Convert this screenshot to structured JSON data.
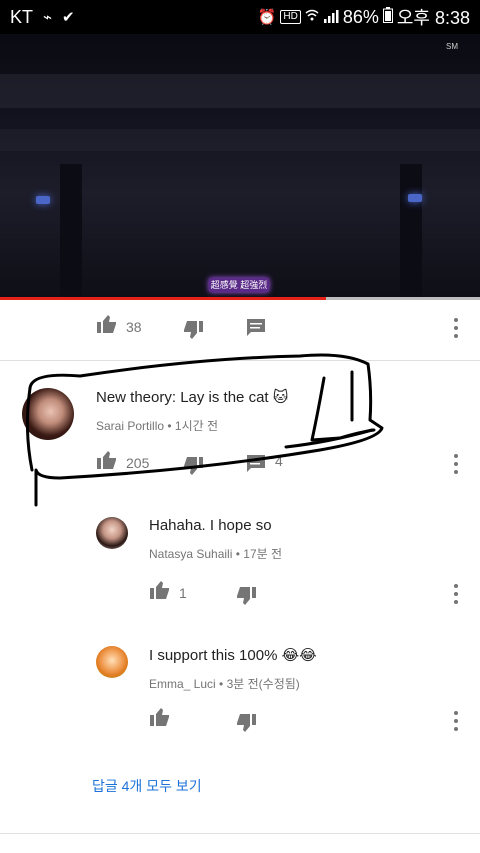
{
  "status_bar": {
    "carrier": "KT",
    "hd_badge": "HD",
    "battery": "86%",
    "time": "오후 8:38"
  },
  "video": {
    "subtitle_text": "超感覺 超強烈",
    "progress_percent": 68,
    "accent_color": "#e62117"
  },
  "video_actions": {
    "like_count": "38"
  },
  "comments": [
    {
      "text": "New theory: Lay is the cat",
      "emoji": "🐱",
      "author": "Sarai Portillo",
      "time": "1시간 전",
      "like_count": "205",
      "reply_count": "4"
    }
  ],
  "replies": [
    {
      "text": "Hahaha. I hope so",
      "author": "Natasya Suhaili",
      "time": "17분 전",
      "like_count": "1"
    },
    {
      "text": "I support this 100% 😂😂",
      "author": "Emma_ Luci",
      "time": "3분 전(수정됨)",
      "like_count": ""
    }
  ],
  "view_all_replies": "답글 4개 모두 보기",
  "separator": "•",
  "colors": {
    "link": "#1e73d8",
    "icon": "#757575",
    "drawing": "#000000"
  }
}
